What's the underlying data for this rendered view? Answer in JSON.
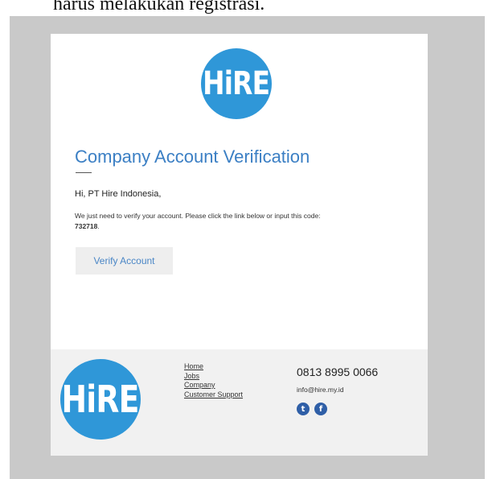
{
  "document": {
    "heading_fragment": "harus melakukan registrasi."
  },
  "email": {
    "logo_text": "HiRE",
    "title": "Company Account Verification",
    "greeting": "Hi, PT Hire Indonesia,",
    "message": "We just need to verify your account. Please click the link below or input this code:",
    "code": "732718",
    "code_suffix": ".",
    "verify_button_label": "Verify Account"
  },
  "footer": {
    "logo_text": "HiRE",
    "links": [
      "Home",
      "Jobs",
      "Company",
      "Customer Support"
    ],
    "phone": "0813 8995 0066",
    "email": "info@hire.my.id",
    "social_icons": [
      "twitter-icon",
      "facebook-icon"
    ],
    "social_glyphs": [
      "t",
      "f"
    ]
  },
  "colors": {
    "brand_blue": "#2f97d8",
    "title_blue": "#3b7fc4",
    "social_blue": "#2f5fa7",
    "backdrop_gray": "#c9c9c9",
    "footer_gray": "#f1f1f1"
  }
}
